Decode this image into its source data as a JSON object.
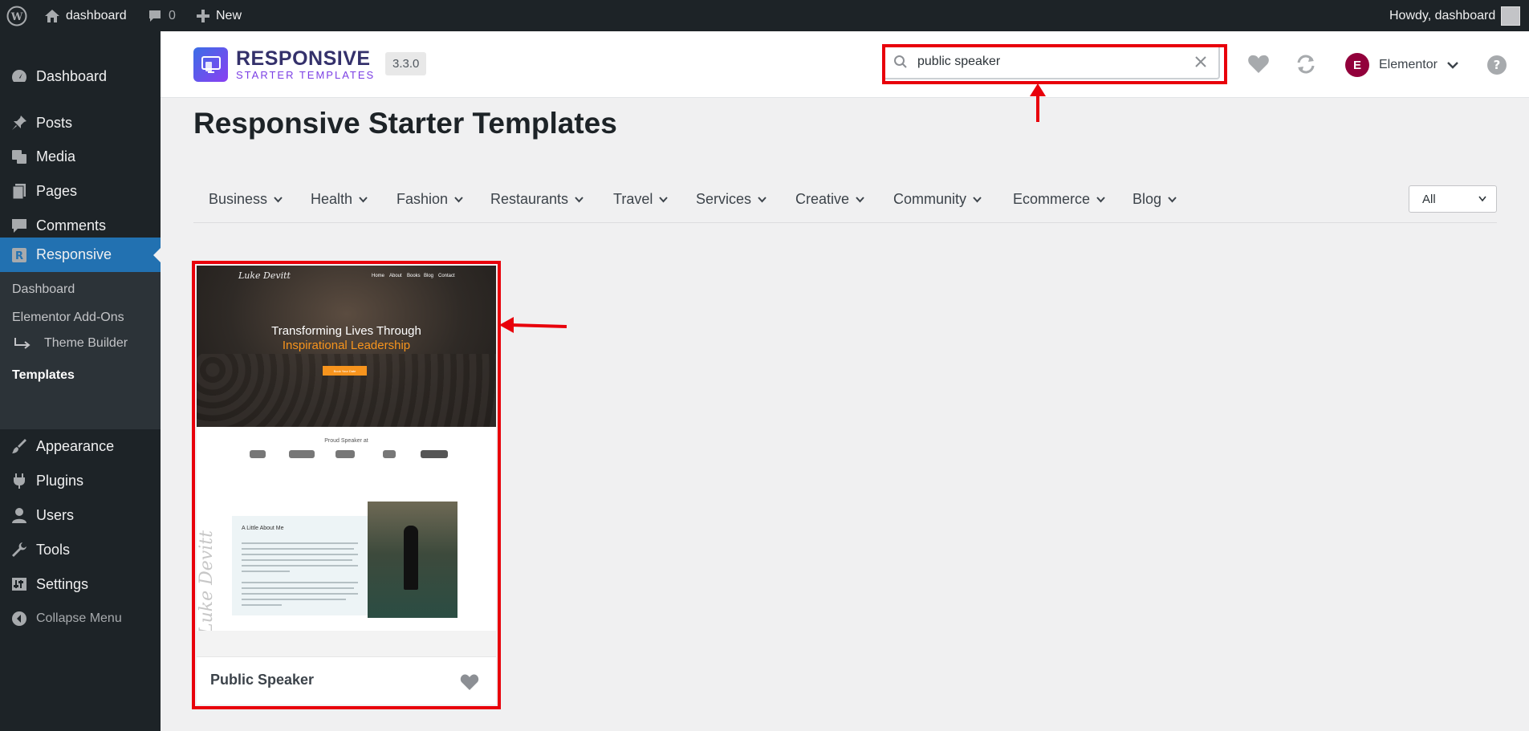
{
  "admin_bar": {
    "site_name": "dashboard",
    "comments_count": "0",
    "new_label": "New",
    "greeting": "Howdy, dashboard"
  },
  "sidebar": {
    "items": [
      {
        "label": "Dashboard",
        "icon": "dashboard-icon"
      },
      {
        "label": "Posts",
        "icon": "pin-icon"
      },
      {
        "label": "Media",
        "icon": "media-icon"
      },
      {
        "label": "Pages",
        "icon": "pages-icon"
      },
      {
        "label": "Comments",
        "icon": "comment-icon"
      },
      {
        "label": "Responsive",
        "icon": "responsive-icon",
        "active": true
      },
      {
        "label": "Appearance",
        "icon": "brush-icon"
      },
      {
        "label": "Plugins",
        "icon": "plugin-icon"
      },
      {
        "label": "Users",
        "icon": "user-icon"
      },
      {
        "label": "Tools",
        "icon": "wrench-icon"
      },
      {
        "label": "Settings",
        "icon": "settings-icon"
      },
      {
        "label": "Collapse Menu",
        "icon": "collapse-icon"
      }
    ],
    "submenu": [
      {
        "label": "Dashboard"
      },
      {
        "label": "Elementor Add-Ons"
      },
      {
        "label": "Theme Builder"
      },
      {
        "label": "Templates",
        "current": true
      }
    ]
  },
  "header": {
    "logo_line1": "RESPONSIVE",
    "logo_line2": "STARTER TEMPLATES",
    "version": "3.3.0",
    "search_value": "public speaker",
    "builder": "Elementor",
    "builder_icon_letter": "E"
  },
  "main": {
    "title": "Responsive Starter Templates",
    "categories": [
      "Business",
      "Health",
      "Fashion",
      "Restaurants",
      "Travel",
      "Services",
      "Creative",
      "Community",
      "Ecommerce",
      "Blog"
    ],
    "filter_value": "All"
  },
  "template_card": {
    "name": "Public Speaker",
    "preview": {
      "logo_text": "Luke Devitt",
      "nav": [
        "Home",
        "About",
        "Books",
        "Blog",
        "Contact"
      ],
      "headline_line1": "Transforming Lives Through",
      "headline_line2": "Inspirational Leadership",
      "cta": "Book Your Date",
      "proud_text": "Proud Speaker at",
      "about_title": "A Little About Me"
    }
  },
  "colors": {
    "accent": "#2271b1",
    "highlight": "#e8000b",
    "sidebar_bg": "#1d2327",
    "elementor": "#92003b"
  }
}
